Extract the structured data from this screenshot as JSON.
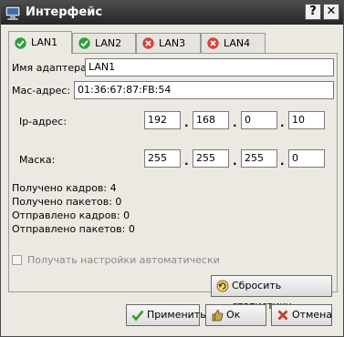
{
  "window": {
    "title": "Интерфейс",
    "help_label": "?",
    "close_label": "✕"
  },
  "tabs": [
    {
      "label": "LAN1",
      "status": "ok",
      "active": true
    },
    {
      "label": "LAN2",
      "status": "ok",
      "active": false
    },
    {
      "label": "LAN3",
      "status": "error",
      "active": false
    },
    {
      "label": "LAN4",
      "status": "error",
      "active": false
    }
  ],
  "adapter": {
    "name_label": "Имя адаптера:",
    "name_value": "LAN1",
    "mac_label": "Mac-адрес:",
    "mac_value": "01:36:67:87:FB:54"
  },
  "ip": {
    "label": "Ip-адрес:",
    "octets": [
      "192",
      "168",
      "0",
      "10"
    ]
  },
  "mask": {
    "label": "Маска:",
    "octets": [
      "255",
      "255",
      "255",
      "0"
    ]
  },
  "separator": ".",
  "stats": {
    "frames_received": "Получено кадров: 4",
    "packets_received": "Получено пакетов: 0",
    "frames_sent": "Отправлено кадров: 0",
    "packets_sent": "Отправлено пакетов: 0"
  },
  "auto_settings": {
    "label": "Получать настройки автоматически",
    "checked": false,
    "enabled": false
  },
  "buttons": {
    "reset_stats": "Сбросить статистику",
    "apply": "Применить",
    "ok": "Ок",
    "cancel": "Отмена"
  },
  "colors": {
    "titlebar": "#333333",
    "ok_icon": "#2e9e3a",
    "error_icon": "#d9433b"
  }
}
